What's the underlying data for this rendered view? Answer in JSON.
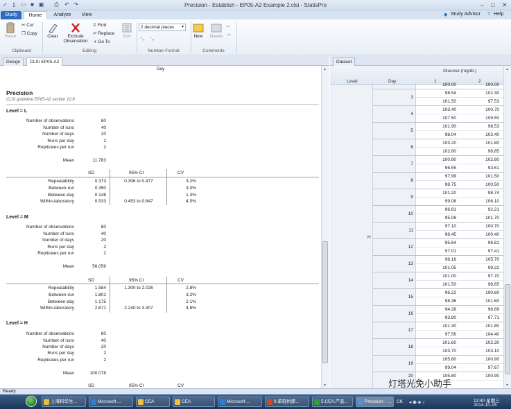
{
  "window": {
    "title": "Precision - Establish - EP05-A2 Example 2.clsi - StatisPro"
  },
  "ribbon_tabs": {
    "study": "Study",
    "home": "Home",
    "analyze": "Analyze",
    "view": "View"
  },
  "header_right": {
    "study_advisor": "Study Advisor",
    "help": "Help"
  },
  "ribbon": {
    "paste": "Paste",
    "cut": "Cut",
    "copy": "Copy",
    "clipboard_label": "Clipboard",
    "clear": "Clear",
    "exclude_1": "Exclude",
    "exclude_2": "Observation",
    "find": "Find",
    "replace": "Replace",
    "goto": "Go To",
    "sort": "Sort",
    "editing_label": "Editing",
    "decimal_places": "2 decimal places",
    "number_format_label": "Number Format",
    "new": "New",
    "delete": "Delete",
    "comments_label": "Comments"
  },
  "panel_tabs": {
    "design": "Design",
    "active": "CLSI EP05-A2",
    "dataset": "Dataset"
  },
  "report": {
    "day_header": "Day",
    "title": "Precision",
    "subtitle": "CLSI guideline EP05-A2 section 10.8",
    "labels": {
      "num_obs": "Number of observations",
      "num_runs": "Number of runs",
      "num_days": "Number of days",
      "runs_per_day": "Runs per day",
      "reps_per_run": "Replicates per run",
      "mean": "Mean",
      "sd": "SD",
      "ci": "95% CI",
      "cv": "CV"
    },
    "levels": [
      {
        "label": "Level = L",
        "stats": {
          "num_obs": "80",
          "num_runs": "40",
          "num_days": "20",
          "runs_per_day": "2",
          "reps_per_run": "2",
          "mean": "11.783"
        },
        "rows": [
          {
            "name": "Repeatability",
            "sd": "0.373",
            "ci": "0.306 to 0.477",
            "cv": "3.2%"
          },
          {
            "name": "Between-run",
            "sd": "0.350",
            "ci": "",
            "cv": "3.0%"
          },
          {
            "name": "Between-day",
            "sd": "0.148",
            "ci": "",
            "cv": "1.3%"
          },
          {
            "name": "Within-laboratory",
            "sd": "0.533",
            "ci": "0.453 to 0.647",
            "cv": "4.5%"
          }
        ]
      },
      {
        "label": "Level = M",
        "stats": {
          "num_obs": "80",
          "num_runs": "40",
          "num_days": "20",
          "runs_per_day": "2",
          "reps_per_run": "2",
          "mean": "56.056"
        },
        "rows": [
          {
            "name": "Repeatability",
            "sd": "1.584",
            "ci": "1.300 to 2.026",
            "cv": "2.8%"
          },
          {
            "name": "Between-run",
            "sd": "1.801",
            "ci": "",
            "cv": "3.2%"
          },
          {
            "name": "Between-day",
            "sd": "1.175",
            "ci": "",
            "cv": "2.1%"
          },
          {
            "name": "Within-laboratory",
            "sd": "2.671",
            "ci": "2.240 to 3.307",
            "cv": "4.8%"
          }
        ]
      },
      {
        "label": "Level = H",
        "stats": {
          "num_obs": "80",
          "num_runs": "40",
          "num_days": "20",
          "runs_per_day": "2",
          "reps_per_run": "2",
          "mean": "100.078"
        },
        "rows": []
      }
    ]
  },
  "dataset": {
    "group_header": "Glucose (mg/dL)",
    "col_level": "Level",
    "col_day": "Day",
    "col_1": "1",
    "col_2": "2",
    "level_value": "H",
    "top_partial": [
      "100.00",
      "100.00"
    ],
    "days": [
      {
        "day": "3",
        "rows": [
          [
            "98.54",
            "102.30"
          ],
          [
            "101.50",
            "97.53"
          ]
        ]
      },
      {
        "day": "4",
        "rows": [
          [
            "103.40",
            "100.70"
          ],
          [
            "107.50",
            "109.50"
          ]
        ]
      },
      {
        "day": "5",
        "rows": [
          [
            "101.90",
            "98.53"
          ],
          [
            "98.04",
            "102.40"
          ]
        ]
      },
      {
        "day": "6",
        "rows": [
          [
            "103.20",
            "101.80"
          ],
          [
            "102.80",
            "96.85"
          ]
        ]
      },
      {
        "day": "7",
        "rows": [
          [
            "100.90",
            "102.80"
          ],
          [
            "96.55",
            "93.61"
          ]
        ]
      },
      {
        "day": "8",
        "rows": [
          [
            "97.99",
            "101.50"
          ],
          [
            "98.75",
            "100.50"
          ]
        ]
      },
      {
        "day": "9",
        "rows": [
          [
            "101.20",
            "98.74"
          ],
          [
            "99.08",
            "106.10"
          ]
        ]
      },
      {
        "day": "10",
        "rows": [
          [
            "96.81",
            "92.21"
          ],
          [
            "95.08",
            "101.70"
          ]
        ]
      },
      {
        "day": "11",
        "rows": [
          [
            "97.10",
            "100.70"
          ],
          [
            "98.45",
            "100.40"
          ]
        ]
      },
      {
        "day": "12",
        "rows": [
          [
            "95.64",
            "96.81"
          ],
          [
            "97.01",
            "97.41"
          ]
        ]
      },
      {
        "day": "13",
        "rows": [
          [
            "98.16",
            "105.70"
          ],
          [
            "101.05",
            "99.22"
          ]
        ]
      },
      {
        "day": "14",
        "rows": [
          [
            "101.00",
            "97.70"
          ],
          [
            "101.50",
            "98.65"
          ]
        ]
      },
      {
        "day": "15",
        "rows": [
          [
            "96.22",
            "100.60"
          ],
          [
            "98.36",
            "101.60"
          ]
        ]
      },
      {
        "day": "16",
        "rows": [
          [
            "94.28",
            "98.89"
          ],
          [
            "93.80",
            "97.71"
          ]
        ]
      },
      {
        "day": "17",
        "rows": [
          [
            "101.30",
            "101.80"
          ],
          [
            "97.56",
            "104.40"
          ]
        ]
      },
      {
        "day": "18",
        "rows": [
          [
            "101.60",
            "102.30"
          ],
          [
            "103.70",
            "103.10"
          ]
        ]
      },
      {
        "day": "19",
        "rows": [
          [
            "105.80",
            "100.90"
          ],
          [
            "99.04",
            "97.67"
          ]
        ]
      },
      {
        "day": "20",
        "rows": [
          [
            "105.80",
            "100.90"
          ]
        ]
      }
    ]
  },
  "status": {
    "text": "Ready"
  },
  "taskbar": {
    "items": [
      "上海科华生...",
      "Microsoft ...",
      "CEA",
      "CEA",
      "Microsoft ...",
      "9.单轻抗原...",
      "5.CEA.产品...",
      "Precision - ..."
    ],
    "lang": "CK",
    "time": "13:40 星期三",
    "date": "2014-10-15"
  },
  "watermark": "灯塔光免小助手",
  "colors": {
    "study_tab": "#2f6cbf",
    "taskbar": "#1d3658",
    "ribbon_bg": "#e9eff7"
  }
}
